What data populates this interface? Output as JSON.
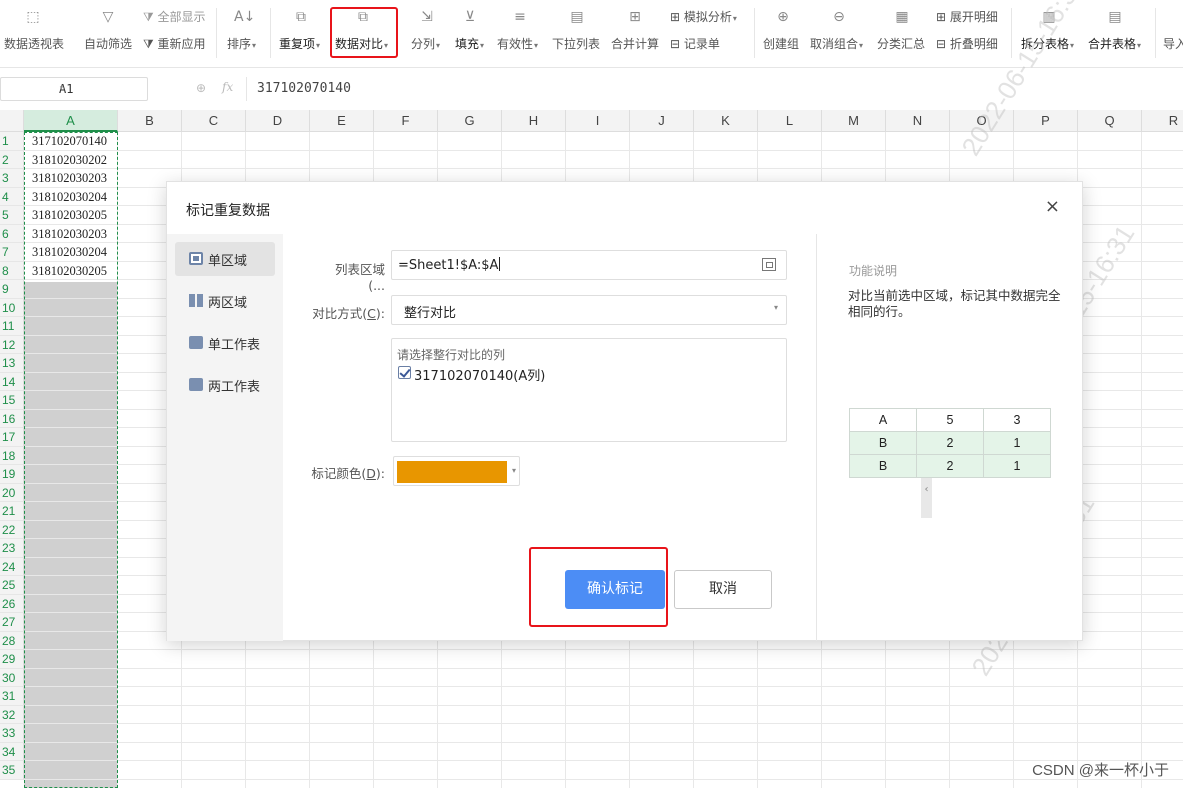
{
  "toolbar": {
    "items": [
      {
        "label": "数据透视表",
        "icon": "pivot-table-icon"
      },
      {
        "label": "自动筛选",
        "icon": "funnel-icon"
      },
      {
        "label": "全部显示",
        "icon": "show-all-icon"
      },
      {
        "label": "重新应用",
        "icon": "reapply-icon"
      },
      {
        "label": "排序",
        "icon": "sort-icon"
      },
      {
        "label": "重复项",
        "icon": "duplicates-icon"
      },
      {
        "label": "数据对比",
        "icon": "data-compare-icon"
      },
      {
        "label": "分列",
        "icon": "split-columns-icon"
      },
      {
        "label": "填充",
        "icon": "fill-icon"
      },
      {
        "label": "有效性",
        "icon": "validation-icon"
      },
      {
        "label": "下拉列表",
        "icon": "dropdown-list-icon"
      },
      {
        "label": "合并计算",
        "icon": "consolidate-icon"
      },
      {
        "label": "模拟分析",
        "icon": "what-if-icon"
      },
      {
        "label": "记录单",
        "icon": "record-form-icon"
      },
      {
        "label": "创建组",
        "icon": "group-icon"
      },
      {
        "label": "取消组合",
        "icon": "ungroup-icon"
      },
      {
        "label": "分类汇总",
        "icon": "subtotal-icon"
      },
      {
        "label": "展开明细",
        "icon": "expand-detail-icon"
      },
      {
        "label": "折叠明细",
        "icon": "collapse-detail-icon"
      },
      {
        "label": "拆分表格",
        "icon": "split-table-icon"
      },
      {
        "label": "合并表格",
        "icon": "merge-table-icon"
      },
      {
        "label": "导入",
        "icon": "import-icon"
      }
    ]
  },
  "formula_bar": {
    "name_box": "A1",
    "fx_label": "fx",
    "value": "317102070140"
  },
  "sheet": {
    "columns": [
      "A",
      "B",
      "C",
      "D",
      "E",
      "F",
      "G",
      "H",
      "I",
      "J",
      "K",
      "L",
      "M",
      "N",
      "O",
      "P",
      "Q",
      "R"
    ],
    "rows": [
      "1",
      "2",
      "3",
      "4",
      "5",
      "6",
      "7",
      "8",
      "9",
      "10",
      "11",
      "12",
      "13",
      "14",
      "15",
      "16",
      "17",
      "18",
      "19",
      "20",
      "21",
      "22",
      "23",
      "24",
      "25",
      "26",
      "27",
      "28",
      "29",
      "30",
      "31",
      "32",
      "33",
      "34",
      "35"
    ],
    "col_a_values": [
      "317102070140",
      "318102030202",
      "318102030203",
      "318102030204",
      "318102030205",
      "318102030203",
      "318102030204",
      "318102030205"
    ],
    "selected_column": "A"
  },
  "dialog": {
    "title": "标记重复数据",
    "close": "×",
    "nav": [
      {
        "label": "单区域",
        "active": true
      },
      {
        "label": "两区域",
        "active": false
      },
      {
        "label": "单工作表",
        "active": false
      },
      {
        "label": "两工作表",
        "active": false
      }
    ],
    "range_label": "列表区域(...",
    "range_value": "=Sheet1!$A:$A",
    "compare_label_prefix": "对比方式(",
    "compare_label_key": "C",
    "compare_label_suffix": "):",
    "compare_value": "整行对比",
    "columns_hint": "请选择整行对比的列",
    "column_option": "317102070140(A列)",
    "color_label_prefix": "标记颜色(",
    "color_label_key": "D",
    "color_label_suffix": "):",
    "mark_color": "#e89600",
    "ok": "确认标记",
    "cancel": "取消",
    "collapse": "‹",
    "desc_title": "功能说明",
    "desc_text": "对比当前选中区域，标记其中数据完全相同的行。",
    "demo_table": [
      [
        "A",
        "5",
        "3"
      ],
      [
        "B",
        "2",
        "1"
      ],
      [
        "B",
        "2",
        "1"
      ]
    ]
  },
  "watermark": "2022-06-15-16:31",
  "credit": "CSDN @来一杯小于",
  "colors": {
    "accent": "#4c8df5",
    "highlight": "#e8141a",
    "selection": "#1f8f4a"
  }
}
